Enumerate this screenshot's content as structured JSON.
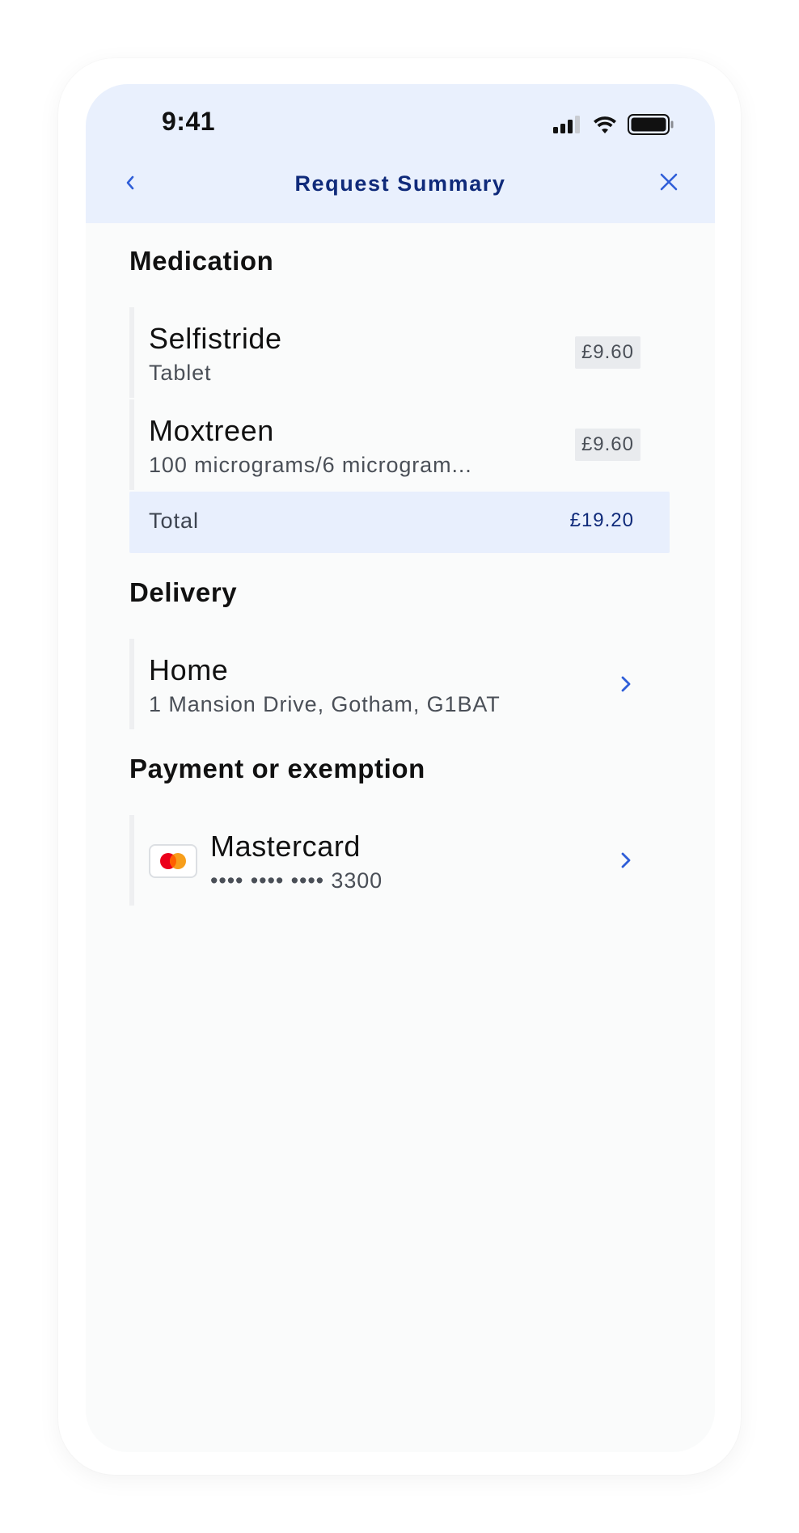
{
  "status_bar": {
    "time": "9:41",
    "icons": [
      "signal-icon",
      "wifi-icon",
      "battery-icon"
    ]
  },
  "header": {
    "title": "Request Summary",
    "back_icon": "chevron-left-icon",
    "close_icon": "close-icon"
  },
  "medication": {
    "section_title": "Medication",
    "items": [
      {
        "name": "Selfistride",
        "form": "Tablet",
        "price": "£9.60"
      },
      {
        "name": "Moxtreen",
        "form": "100 micrograms/6 microgram...",
        "price": "£9.60"
      }
    ],
    "total_label": "Total",
    "total_value": "£19.20"
  },
  "delivery": {
    "section_title": "Delivery",
    "name": "Home",
    "address": "1 Mansion Drive, Gotham, G1BAT"
  },
  "payment": {
    "section_title": "Payment or exemption",
    "card_name": "Mastercard",
    "card_number": "•••• •••• •••• 3300",
    "card_icon": "mastercard-icon"
  },
  "colors": {
    "header_bg": "#e9f0fd",
    "title_navy": "#0f2a7a",
    "accent_blue": "#2f5ed8",
    "screen_bg": "#fafbfb",
    "total_bg": "#e8effd",
    "badge_bg": "#e9ebee",
    "mastercard_red": "#eb001b",
    "mastercard_orange": "#f79e1b"
  }
}
